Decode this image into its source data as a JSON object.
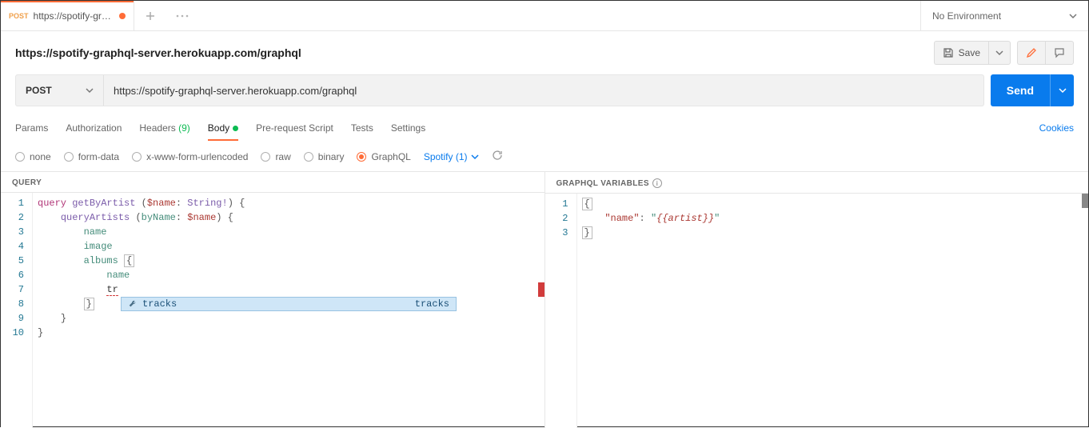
{
  "tabBar": {
    "activeTab": {
      "method": "POST",
      "title": "https://spotify-gr…"
    }
  },
  "env": {
    "label": "No Environment"
  },
  "request": {
    "title": "https://spotify-graphql-server.herokuapp.com/graphql",
    "saveLabel": "Save",
    "method": "POST",
    "url": "https://spotify-graphql-server.herokuapp.com/graphql",
    "sendLabel": "Send"
  },
  "reqTabs": {
    "params": "Params",
    "auth": "Authorization",
    "headersLabel": "Headers",
    "headersCount": "(9)",
    "body": "Body",
    "prs": "Pre-request Script",
    "tests": "Tests",
    "settings": "Settings",
    "cookies": "Cookies"
  },
  "bodyTypes": {
    "none": "none",
    "formData": "form-data",
    "urlencoded": "x-www-form-urlencoded",
    "raw": "raw",
    "binary": "binary",
    "graphql": "GraphQL",
    "schema": "Spotify (1)"
  },
  "panels": {
    "queryLabel": "QUERY",
    "varsLabel": "GRAPHQL VARIABLES"
  },
  "query": {
    "l1_kw": "query",
    "l1_fn": "getByArtist",
    "l1_var": "$name",
    "l1_type": "String!",
    "l2_fn": "queryArtists",
    "l2_arg": "byName",
    "l2_var": "$name",
    "l3": "name",
    "l4": "image",
    "l5": "albums",
    "l6": "name",
    "l7": "tr"
  },
  "variables": {
    "braceOpen": "{",
    "braceClose": "}",
    "key": "\"name\"",
    "colon": ": ",
    "q": "\"",
    "tmpl": "{{artist}}"
  },
  "autocomplete": {
    "name": "tracks",
    "hint": "tracks"
  }
}
